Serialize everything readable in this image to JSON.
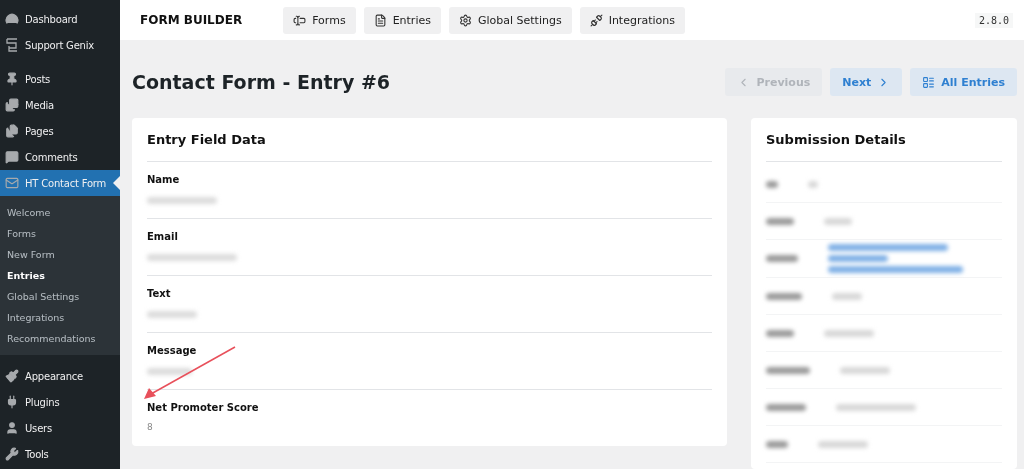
{
  "sidebar": {
    "items": [
      {
        "label": "Dashboard",
        "selected": false
      },
      {
        "label": "Support Genix",
        "selected": false
      },
      {
        "label": "Posts",
        "selected": false
      },
      {
        "label": "Media",
        "selected": false
      },
      {
        "label": "Pages",
        "selected": false
      },
      {
        "label": "Comments",
        "selected": false
      },
      {
        "label": "HT Contact Form",
        "selected": true,
        "children": [
          {
            "label": "Welcome",
            "selected": false
          },
          {
            "label": "Forms",
            "selected": false
          },
          {
            "label": "New Form",
            "selected": false
          },
          {
            "label": "Entries",
            "selected": true
          },
          {
            "label": "Global Settings",
            "selected": false
          },
          {
            "label": "Integrations",
            "selected": false
          },
          {
            "label": "Recommendations",
            "selected": false
          }
        ]
      },
      {
        "label": "Appearance",
        "selected": false
      },
      {
        "label": "Plugins",
        "selected": false
      },
      {
        "label": "Users",
        "selected": false
      },
      {
        "label": "Tools",
        "selected": false
      }
    ]
  },
  "topbar": {
    "title": "FORM BUILDER",
    "tabs": [
      {
        "label": "Forms"
      },
      {
        "label": "Entries"
      },
      {
        "label": "Global Settings"
      },
      {
        "label": "Integrations"
      }
    ],
    "version": "2.8.0"
  },
  "page": {
    "title": "Contact Form - Entry #6",
    "buttons": [
      {
        "label": "Previous",
        "kind": "prev",
        "disabled": true
      },
      {
        "label": "Next",
        "kind": "next",
        "disabled": false
      },
      {
        "label": "All Entries",
        "kind": "all",
        "disabled": false
      }
    ]
  },
  "entry_card": {
    "title": "Entry Field Data",
    "fields": [
      {
        "label": "Name"
      },
      {
        "label": "Email"
      },
      {
        "label": "Text"
      },
      {
        "label": "Message"
      },
      {
        "label": "Net Promoter Score",
        "value": "8"
      }
    ]
  },
  "details_card": {
    "title": "Submission Details",
    "rows": [
      {
        "kind": "text"
      },
      {
        "kind": "text"
      },
      {
        "kind": "link"
      },
      {
        "kind": "text"
      },
      {
        "kind": "text"
      },
      {
        "kind": "text"
      },
      {
        "kind": "text"
      },
      {
        "kind": "text"
      }
    ]
  }
}
